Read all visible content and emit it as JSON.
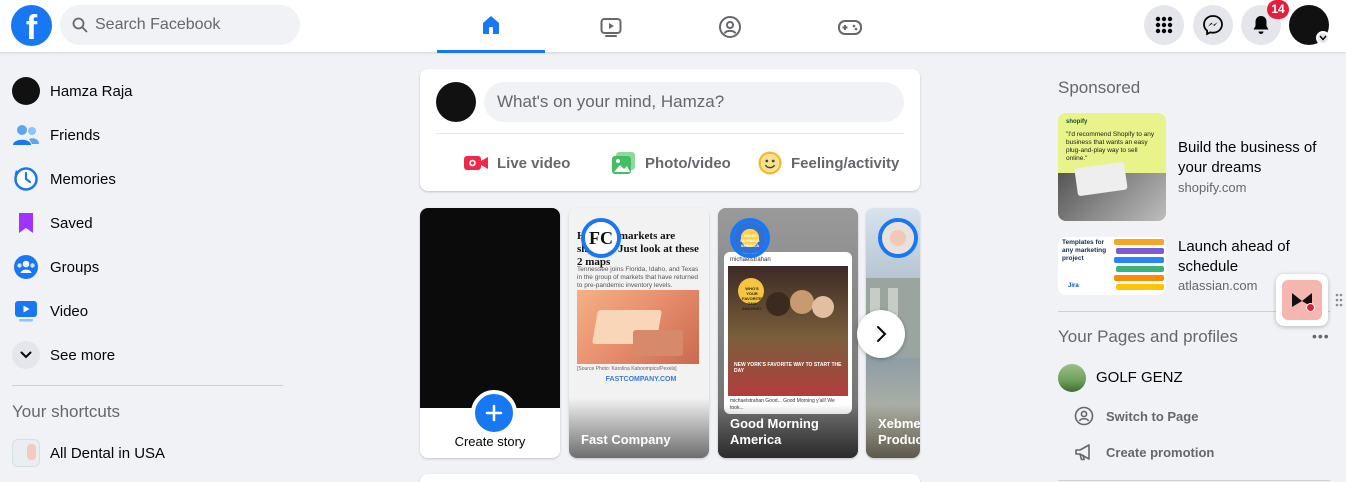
{
  "colors": {
    "brand": "#1877f2",
    "badge": "#e41e3f",
    "text": "#050505",
    "secondary": "#65676b"
  },
  "header": {
    "logo_glyph": "f",
    "search": {
      "placeholder": "Search Facebook"
    },
    "nav_tabs": [
      {
        "icon": "home-icon",
        "active": true
      },
      {
        "icon": "watch-icon",
        "active": false
      },
      {
        "icon": "groups-icon",
        "active": false
      },
      {
        "icon": "gaming-icon",
        "active": false
      }
    ],
    "menu_icon": "grid-menu-icon",
    "messenger_icon": "messenger-icon",
    "notifications": {
      "icon": "bell-icon",
      "count": "14"
    }
  },
  "sidebar": {
    "items": [
      {
        "label": "Hamza Raja",
        "icon": "profile-avatar"
      },
      {
        "label": "Friends",
        "icon": "friends-icon"
      },
      {
        "label": "Memories",
        "icon": "memories-icon"
      },
      {
        "label": "Saved",
        "icon": "saved-icon"
      },
      {
        "label": "Groups",
        "icon": "groups-icon"
      },
      {
        "label": "Video",
        "icon": "video-icon"
      },
      {
        "label": "See more",
        "icon": "chevron-down-icon"
      }
    ],
    "shortcuts_title": "Your shortcuts",
    "shortcuts": [
      {
        "label": "All Dental in USA"
      }
    ]
  },
  "composer": {
    "placeholder": "What's on your mind, Hamza?",
    "actions": [
      {
        "label": "Live video",
        "icon": "live-video-icon",
        "color": "#f02849"
      },
      {
        "label": "Photo/video",
        "icon": "photo-icon",
        "color": "#45bd62"
      },
      {
        "label": "Feeling/activity",
        "icon": "feeling-icon",
        "color": "#f7b928"
      }
    ]
  },
  "stories": {
    "create_label": "Create story",
    "items": [
      {
        "label": "Fast Company",
        "avatar_text": "FC",
        "headline": "Housing markets are shifting. Just look at these 2 maps",
        "body": "Tennessee joins Florida, Idaho, and Texas in the group of markets that have returned to pre-pandemic inventory levels.",
        "credit": "[Source Photo: Karolina Kaboompics/Pexels]",
        "site": "FASTCOMPANY.COM"
      },
      {
        "label": "Good Morning America",
        "avatar_text": "GOOD MORNING AMERICA",
        "post_user": "michaelstrahan",
        "promo_text": "WHO'S YOUR FAVORITE GMA ANCHOR?",
        "caption": "michaelstrahan Good... Good Morning y'all! We took...",
        "overlay": "NEW YORK'S FAVORITE WAY TO START THE DAY"
      },
      {
        "label": "Xebme Produc"
      }
    ]
  },
  "right": {
    "sponsored_title": "Sponsored",
    "ads": [
      {
        "title": "Build the business of your dreams",
        "domain": "shopify.com",
        "image_brand": "shopify",
        "image_quote": "\"I'd recommend Shopify to any business that wants an easy plug-and-play way to sell online.\""
      },
      {
        "title": "Launch ahead of schedule",
        "domain": "atlassian.com",
        "image_heading": "Templates for any marketing project",
        "image_brand": "Jira"
      }
    ],
    "pages_title": "Your Pages and profiles",
    "more_glyph": "•••",
    "page": {
      "name": "GOLF GENZ",
      "actions": [
        {
          "label": "Switch to Page",
          "icon": "switch-profile-icon"
        },
        {
          "label": "Create promotion",
          "icon": "megaphone-icon"
        }
      ]
    }
  }
}
